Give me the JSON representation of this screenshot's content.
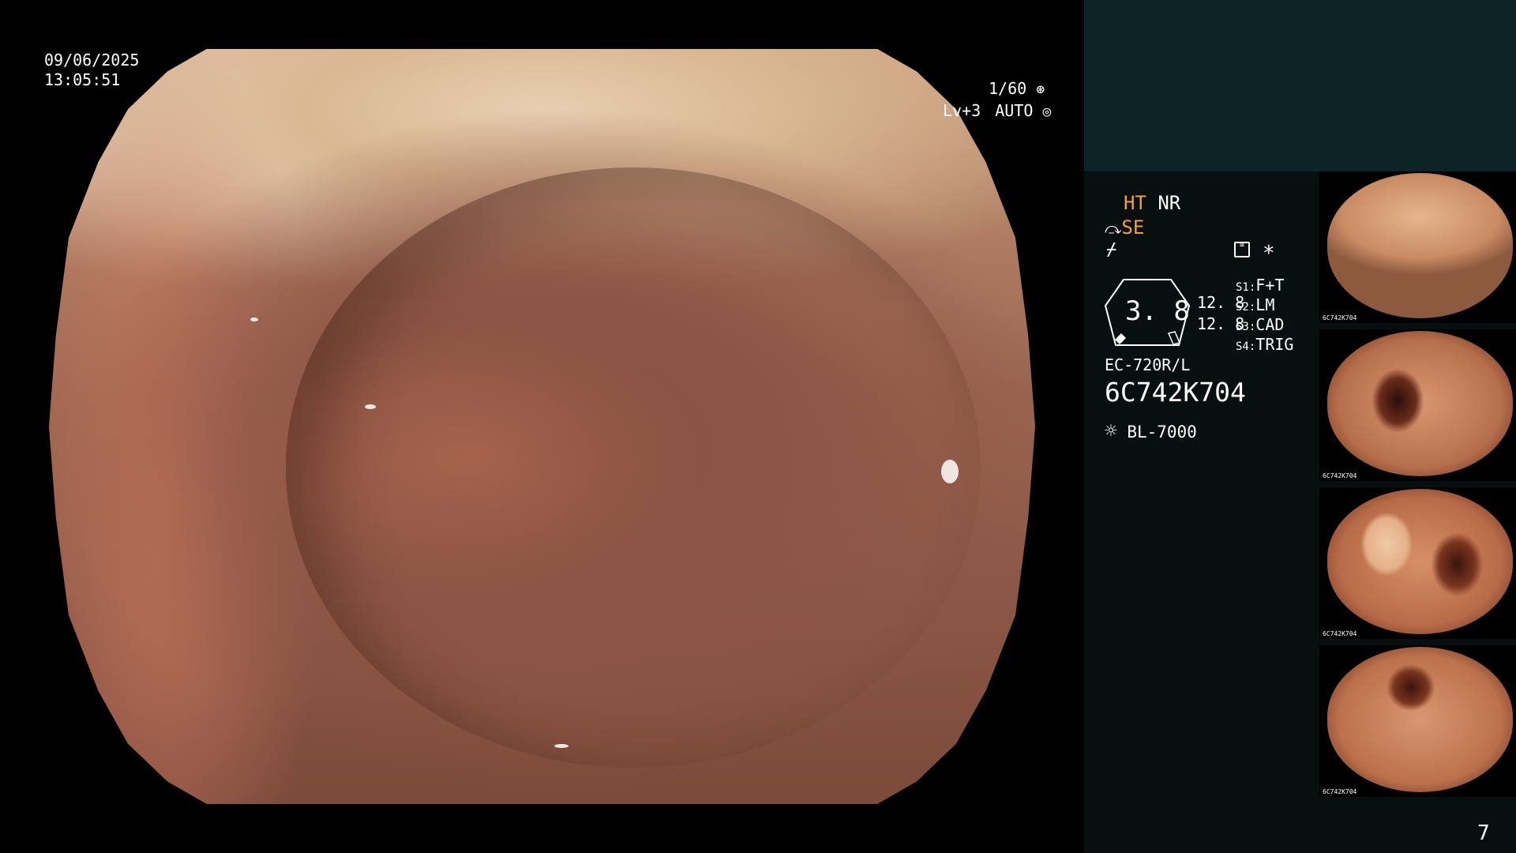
{
  "scope": {
    "date": "09/06/2025",
    "time": "13:05:51",
    "shutter": "1/60",
    "level": "Lv+3",
    "mode": "AUTO"
  },
  "panel": {
    "enhance_ht": "HT",
    "enhance_nr": "NR",
    "enhance_se": "SE",
    "zoom_value": "3. 8",
    "depth_top": "12. 8",
    "depth_bottom": "12. 8",
    "switches": [
      {
        "key": "S1",
        "value": "F+T"
      },
      {
        "key": "S2",
        "value": "LM"
      },
      {
        "key": "S3",
        "value": "CAD"
      },
      {
        "key": "S4",
        "value": "TRIG"
      }
    ],
    "asterisk": "*",
    "scope_model": "EC-720R/L",
    "serial": "6C742K704",
    "light_source": "BL-7000",
    "page_number": "7"
  },
  "thumbnails": [
    {
      "caption": "6C742K704"
    },
    {
      "caption": "6C742K704"
    },
    {
      "caption": "6C742K704"
    },
    {
      "caption": "6C742K704"
    }
  ],
  "colors": {
    "accent_orange": "#f3a03a",
    "panel_background": "#07100f",
    "panel_top_background": "#0b2426"
  },
  "icons": [
    "shutter-icon",
    "auto-iris-icon",
    "enhance-icon",
    "freeze-icon",
    "memory-card-icon",
    "light-source-icon"
  ]
}
